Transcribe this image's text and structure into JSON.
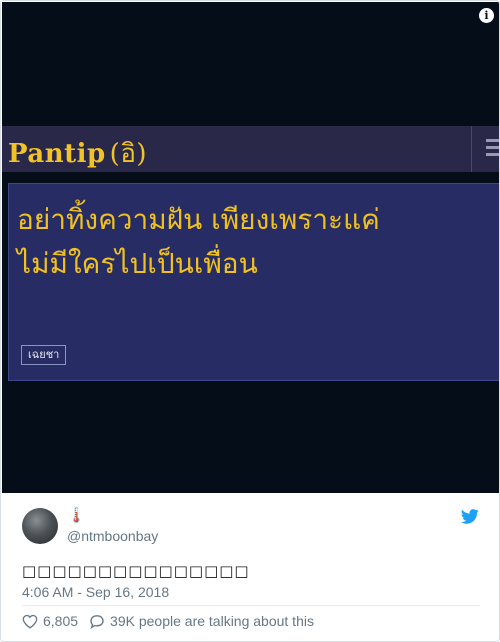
{
  "media": {
    "info_icon": "info-icon",
    "site_logo_text": "Pantip",
    "site_logo_mark": "(อิ)",
    "post_title_line1": "อย่าทิ้งความฝัน เพียงเพราะแค่",
    "post_title_line2": "ไม่มีใครไปเป็นเพื่อน",
    "post_tag": "เฉยชา",
    "colors": {
      "background": "#050d18",
      "bar": "#2a2849",
      "panel": "#272c65",
      "accent": "#f1c21f"
    }
  },
  "tweet": {
    "display_name_icon": "thermometer-icon",
    "display_name": "🌡️",
    "handle": "@ntmboonbay",
    "text": "□□□□□□□□□□□□□□□",
    "timestamp": "4:06 AM - Sep 16, 2018",
    "likes": "6,805",
    "talking": "39K people are talking about this",
    "twitter_icon": "twitter-bird-icon",
    "colors": {
      "twitter_blue": "#1da1f2",
      "meta_gray": "#657786"
    }
  }
}
